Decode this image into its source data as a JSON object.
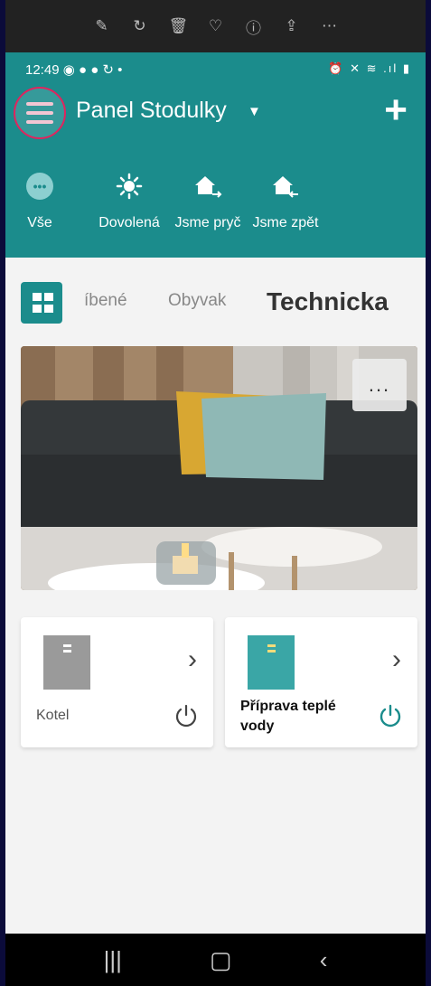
{
  "viewer_toolbar": {
    "icons": [
      "edit-icon",
      "rotate-icon",
      "delete-icon",
      "favorite-icon",
      "info-icon",
      "share-icon",
      "more-icon"
    ],
    "glyphs": [
      "✎",
      "↻",
      "🗑",
      "♡",
      "ⓘ",
      "⇪",
      "⋯"
    ]
  },
  "status_bar": {
    "time": "12:49 ◉ ● ● ↻ •",
    "right": "⏰ ✕ ≋ .ıl ▮"
  },
  "header": {
    "title": "Panel Stodulky",
    "dropdown_glyph": "▼",
    "add_glyph": "+",
    "scenes": [
      {
        "label": "Vše",
        "icon": "more-circle-icon"
      },
      {
        "label": "Dovolená",
        "icon": "sun-icon"
      },
      {
        "label": "Jsme pryč",
        "icon": "home-leave-icon"
      },
      {
        "label": "Jsme zpět",
        "icon": "home-return-icon"
      }
    ]
  },
  "tabs": [
    {
      "label": "íbené",
      "active": false
    },
    {
      "label": "Obyvak",
      "active": false
    },
    {
      "label": "Technicka",
      "active": true
    }
  ],
  "room": {
    "more_glyph": "..."
  },
  "devices": [
    {
      "name": "Kotel",
      "color": "#9a9a9a",
      "chevron": "›"
    },
    {
      "name": "Příprava teplé vody",
      "color": "#3aa6a6",
      "chevron": "›"
    }
  ],
  "nav": {
    "glyphs": [
      "|||",
      "▢",
      "‹"
    ]
  },
  "colors": {
    "accent": "#1b8c8c",
    "highlight_ring": "#e0245e"
  }
}
